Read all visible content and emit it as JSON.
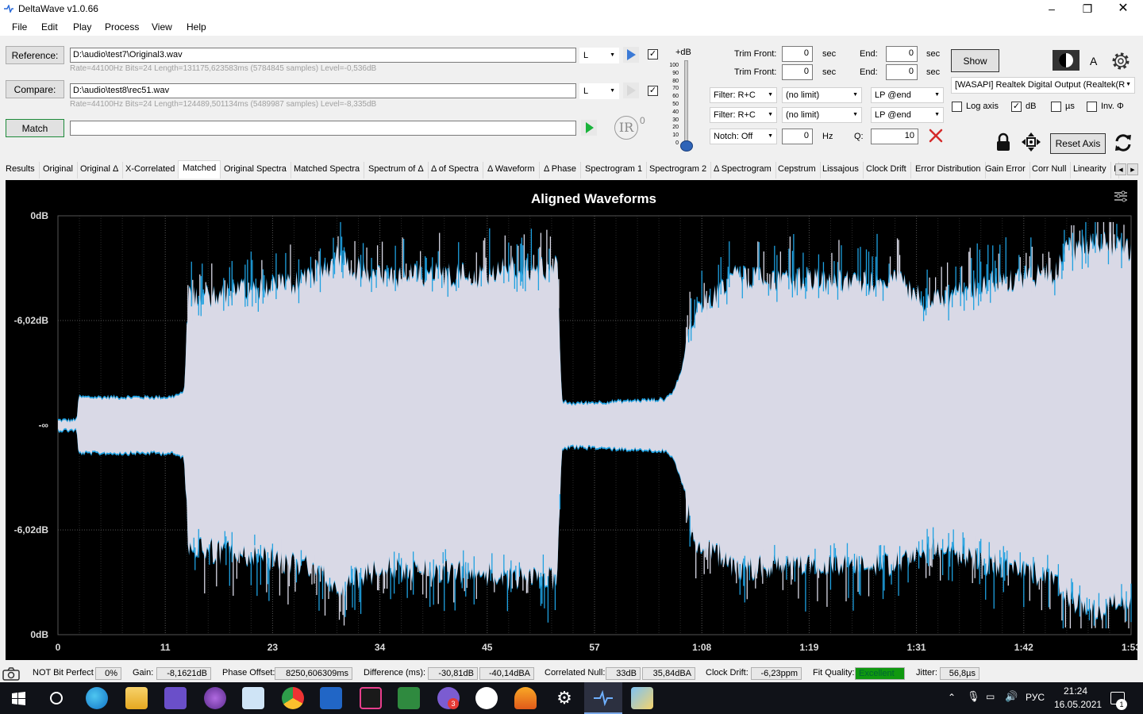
{
  "window": {
    "title": "DeltaWave v1.0.66"
  },
  "menu": [
    "File",
    "Edit",
    "Play",
    "Process",
    "View",
    "Help"
  ],
  "reference": {
    "button": "Reference:",
    "path": "D:\\audio\\test7\\Original3.wav",
    "channel": "L",
    "info": "Rate=44100Hz Bits=24 Length=131175,623583ms (5784845 samples) Level=-0,536dB",
    "checked": true
  },
  "compare": {
    "button": "Compare:",
    "path": "D:\\audio\\test8\\rec51.wav",
    "channel": "L",
    "info": "Rate=44100Hz Bits=24 Length=124489,501134ms (5489987 samples) Level=-8,335dB",
    "checked": true
  },
  "match": {
    "button": "Match",
    "path": ""
  },
  "ir": {
    "label": "IR",
    "sup": "0"
  },
  "db_slider": {
    "label": "+dB",
    "ticks": [
      "100",
      "90",
      "80",
      "70",
      "60",
      "50",
      "40",
      "30",
      "20",
      "10",
      "0"
    ],
    "value": 0
  },
  "trim": [
    {
      "label": "Trim Front:",
      "value": "0",
      "unit": "sec",
      "end_label": "End:",
      "end_value": "0",
      "end_unit": "sec"
    },
    {
      "label": "Trim Front:",
      "value": "0",
      "unit": "sec",
      "end_label": "End:",
      "end_value": "0",
      "end_unit": "sec"
    }
  ],
  "filters": [
    {
      "mode": "Filter: R+C",
      "limit": "(no limit)",
      "lp": "LP @end"
    },
    {
      "mode": "Filter: R+C",
      "limit": "(no limit)",
      "lp": "LP @end"
    }
  ],
  "notch": {
    "mode": "Notch: Off",
    "freq": "0",
    "unit": "Hz",
    "q_label": "Q:",
    "q": "10"
  },
  "output": {
    "show_button": "Show",
    "a_label": "A",
    "device": "[WASAPI] Realtek Digital Output (Realtek(R"
  },
  "options": [
    {
      "label": "Log axis",
      "checked": false
    },
    {
      "label": "dB",
      "checked": true
    },
    {
      "label": "µs",
      "checked": false
    },
    {
      "label": "Inv. Φ",
      "checked": false
    }
  ],
  "reset_axis": "Reset Axis",
  "tabs": [
    "Results",
    "Original",
    "Original Δ",
    "X-Correlated",
    "Matched",
    "Original Spectra",
    "Matched Spectra",
    "Spectrum of Δ",
    "Δ of Spectra",
    "Δ Waveform",
    "Δ Phase",
    "Spectrogram 1",
    "Spectrogram 2",
    "Δ Spectrogram",
    "Cepstrum",
    "Lissajous",
    "Clock Drift",
    "Error Distribution",
    "Gain Error",
    "Corr Null",
    "Linearity",
    "I"
  ],
  "active_tab": "Matched",
  "chart_data": {
    "type": "area",
    "title": "Aligned Waveforms",
    "xticks": [
      "0",
      "11",
      "23",
      "34",
      "45",
      "57",
      "1:08",
      "1:19",
      "1:31",
      "1:42",
      "1:53"
    ],
    "yticks": [
      "0dB",
      "-6,02dB",
      "-∞",
      "-6,02dB",
      "0dB"
    ],
    "xlim": [
      0,
      115
    ],
    "series": [
      {
        "color": "#d9d9e6"
      },
      {
        "color": "#1ea0e0"
      }
    ],
    "envelope": {
      "t": [
        0,
        2,
        2.2,
        12,
        13.5,
        14,
        20,
        26,
        29,
        30,
        31,
        35,
        40,
        45,
        48,
        52,
        53.5,
        54,
        55,
        60,
        65,
        66,
        67,
        68,
        69,
        71,
        72,
        80,
        90,
        92,
        94,
        100,
        107,
        108,
        112,
        115
      ],
      "upper": [
        0.01,
        0.01,
        0.12,
        0.12,
        0.14,
        0.58,
        0.62,
        0.66,
        0.74,
        0.8,
        0.74,
        0.68,
        0.7,
        0.69,
        0.73,
        0.72,
        0.75,
        0.1,
        0.09,
        0.1,
        0.11,
        0.15,
        0.28,
        0.5,
        0.56,
        0.62,
        0.68,
        0.67,
        0.66,
        0.6,
        0.56,
        0.66,
        0.7,
        0.8,
        0.86,
        0.8
      ],
      "lower": [
        0.01,
        0.01,
        0.12,
        0.12,
        0.14,
        0.56,
        0.6,
        0.64,
        0.72,
        0.8,
        0.72,
        0.66,
        0.68,
        0.67,
        0.71,
        0.7,
        0.73,
        0.1,
        0.09,
        0.1,
        0.11,
        0.15,
        0.28,
        0.5,
        0.56,
        0.6,
        0.66,
        0.65,
        0.64,
        0.6,
        0.56,
        0.64,
        0.7,
        0.8,
        0.86,
        0.8
      ]
    }
  },
  "status": {
    "bit_perfect": "NOT Bit Perfect",
    "bit_perfect_pct": "0%",
    "gain_label": "Gain:",
    "gain": "-8,1621dB",
    "phase_label": "Phase Offset:",
    "phase": "8250,606309ms",
    "diff_label": "Difference (ms):",
    "diff1": "-30,81dB",
    "diff2": "-40,14dBA",
    "null_label": "Correlated Null:",
    "null1": "33dB",
    "null2": "35,84dBA",
    "drift_label": "Clock Drift:",
    "drift": "-6,23ppm",
    "fit_label": "Fit Quality:",
    "fit": "Excellent",
    "jitter_label": "Jitter:",
    "jitter": "56,8µs"
  },
  "taskbar": {
    "lang": "РУС",
    "time": "21:24",
    "date": "16.05.2021",
    "notif": "1",
    "badge": "3",
    "apps": [
      "windows-start",
      "search",
      "edge",
      "file-explorer",
      "save-app",
      "podcast-app",
      "mail-app",
      "chrome",
      "ap2-app",
      "intellij",
      "vs-app",
      "viber",
      "potplayer",
      "vlc",
      "settings",
      "deltawave",
      "paint"
    ]
  }
}
